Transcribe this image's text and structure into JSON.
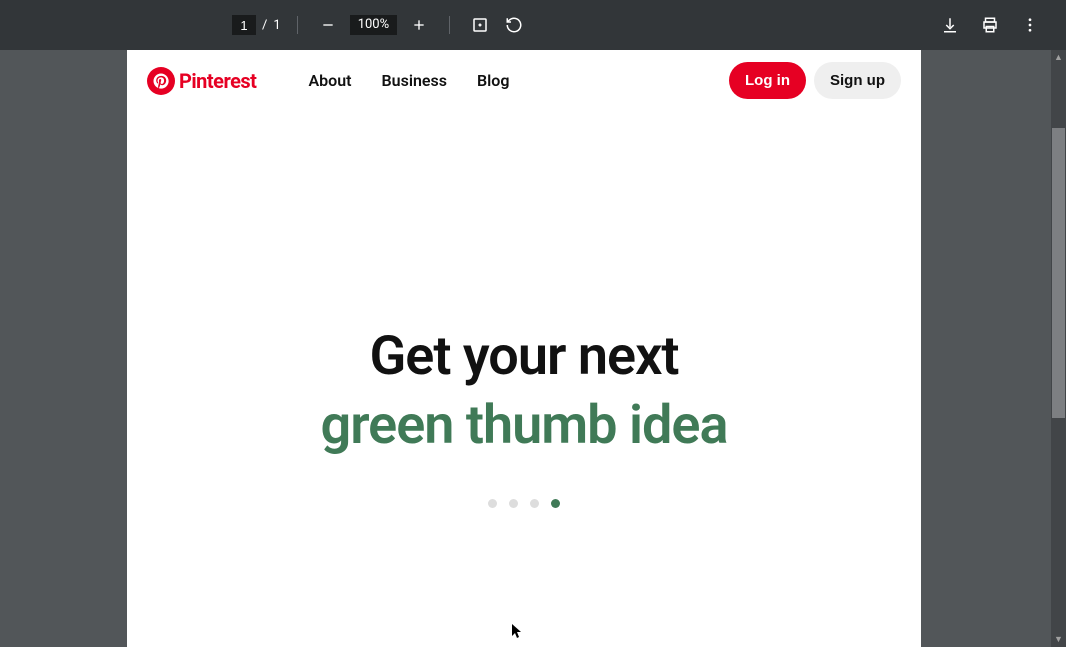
{
  "pdfViewer": {
    "currentPage": "1",
    "pageSeparator": "/",
    "totalPages": "1",
    "zoomLevel": "100%"
  },
  "page": {
    "brand": "Pinterest",
    "nav": {
      "about": "About",
      "business": "Business",
      "blog": "Blog"
    },
    "auth": {
      "login": "Log in",
      "signup": "Sign up"
    },
    "hero": {
      "line1": "Get your next",
      "line2": "green thumb idea"
    },
    "carousel": {
      "dotCount": 4,
      "activeIndex": 3
    }
  },
  "colors": {
    "pinterestRed": "#e60023",
    "heroGreen": "#407a57",
    "toolbarBg": "#323639",
    "pageBg": "#525659"
  }
}
